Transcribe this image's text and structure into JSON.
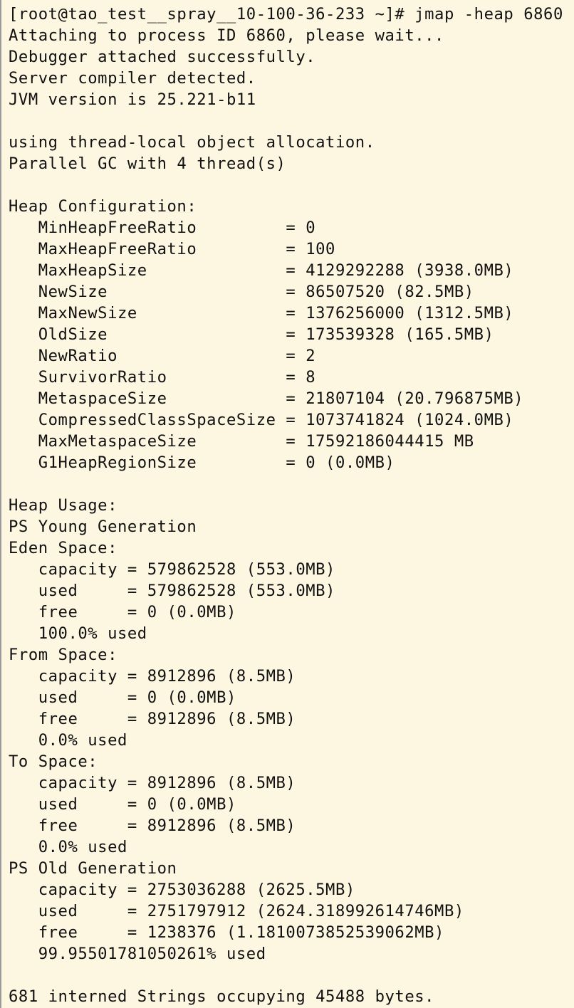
{
  "terminal": {
    "lines": [
      "[root@tao_test__spray__10-100-36-233 ~]# jmap -heap 6860",
      "Attaching to process ID 6860, please wait...",
      "Debugger attached successfully.",
      "Server compiler detected.",
      "JVM version is 25.221-b11",
      "",
      "using thread-local object allocation.",
      "Parallel GC with 4 thread(s)",
      "",
      "Heap Configuration:",
      "   MinHeapFreeRatio         = 0",
      "   MaxHeapFreeRatio         = 100",
      "   MaxHeapSize              = 4129292288 (3938.0MB)",
      "   NewSize                  = 86507520 (82.5MB)",
      "   MaxNewSize               = 1376256000 (1312.5MB)",
      "   OldSize                  = 173539328 (165.5MB)",
      "   NewRatio                 = 2",
      "   SurvivorRatio            = 8",
      "   MetaspaceSize            = 21807104 (20.796875MB)",
      "   CompressedClassSpaceSize = 1073741824 (1024.0MB)",
      "   MaxMetaspaceSize         = 17592186044415 MB",
      "   G1HeapRegionSize         = 0 (0.0MB)",
      "",
      "Heap Usage:",
      "PS Young Generation",
      "Eden Space:",
      "   capacity = 579862528 (553.0MB)",
      "   used     = 579862528 (553.0MB)",
      "   free     = 0 (0.0MB)",
      "   100.0% used",
      "From Space:",
      "   capacity = 8912896 (8.5MB)",
      "   used     = 0 (0.0MB)",
      "   free     = 8912896 (8.5MB)",
      "   0.0% used",
      "To Space:",
      "   capacity = 8912896 (8.5MB)",
      "   used     = 0 (0.0MB)",
      "   free     = 8912896 (8.5MB)",
      "   0.0% used",
      "PS Old Generation",
      "   capacity = 2753036288 (2625.5MB)",
      "   used     = 2751797912 (2624.318992614746MB)",
      "   free     = 1238376 (1.1810073852539062MB)",
      "   99.95501781050261% used",
      "",
      "681 interned Strings occupying 45488 bytes."
    ]
  }
}
